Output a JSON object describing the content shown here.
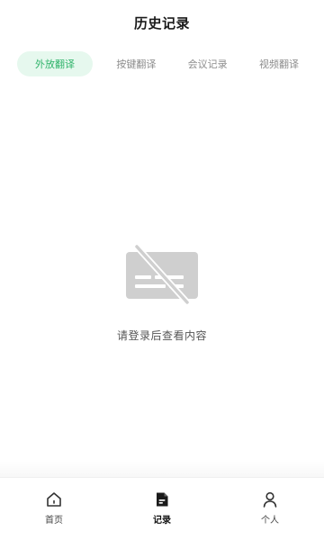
{
  "header": {
    "title": "历史记录"
  },
  "tabs": [
    {
      "label": "外放翻译",
      "active": true
    },
    {
      "label": "按键翻译",
      "active": false
    },
    {
      "label": "会议记录",
      "active": false
    },
    {
      "label": "视频翻译",
      "active": false
    }
  ],
  "empty_state": {
    "icon": "no-subtitles-icon",
    "message": "请登录后查看内容"
  },
  "tabbar": [
    {
      "label": "首页",
      "icon": "home-icon",
      "active": false
    },
    {
      "label": "记录",
      "icon": "record-icon",
      "active": true
    },
    {
      "label": "个人",
      "icon": "person-icon",
      "active": false
    }
  ],
  "colors": {
    "accent": "#2fb36a",
    "accent_bg": "#e6f8ee",
    "icon_gray": "#cfcfcf"
  }
}
